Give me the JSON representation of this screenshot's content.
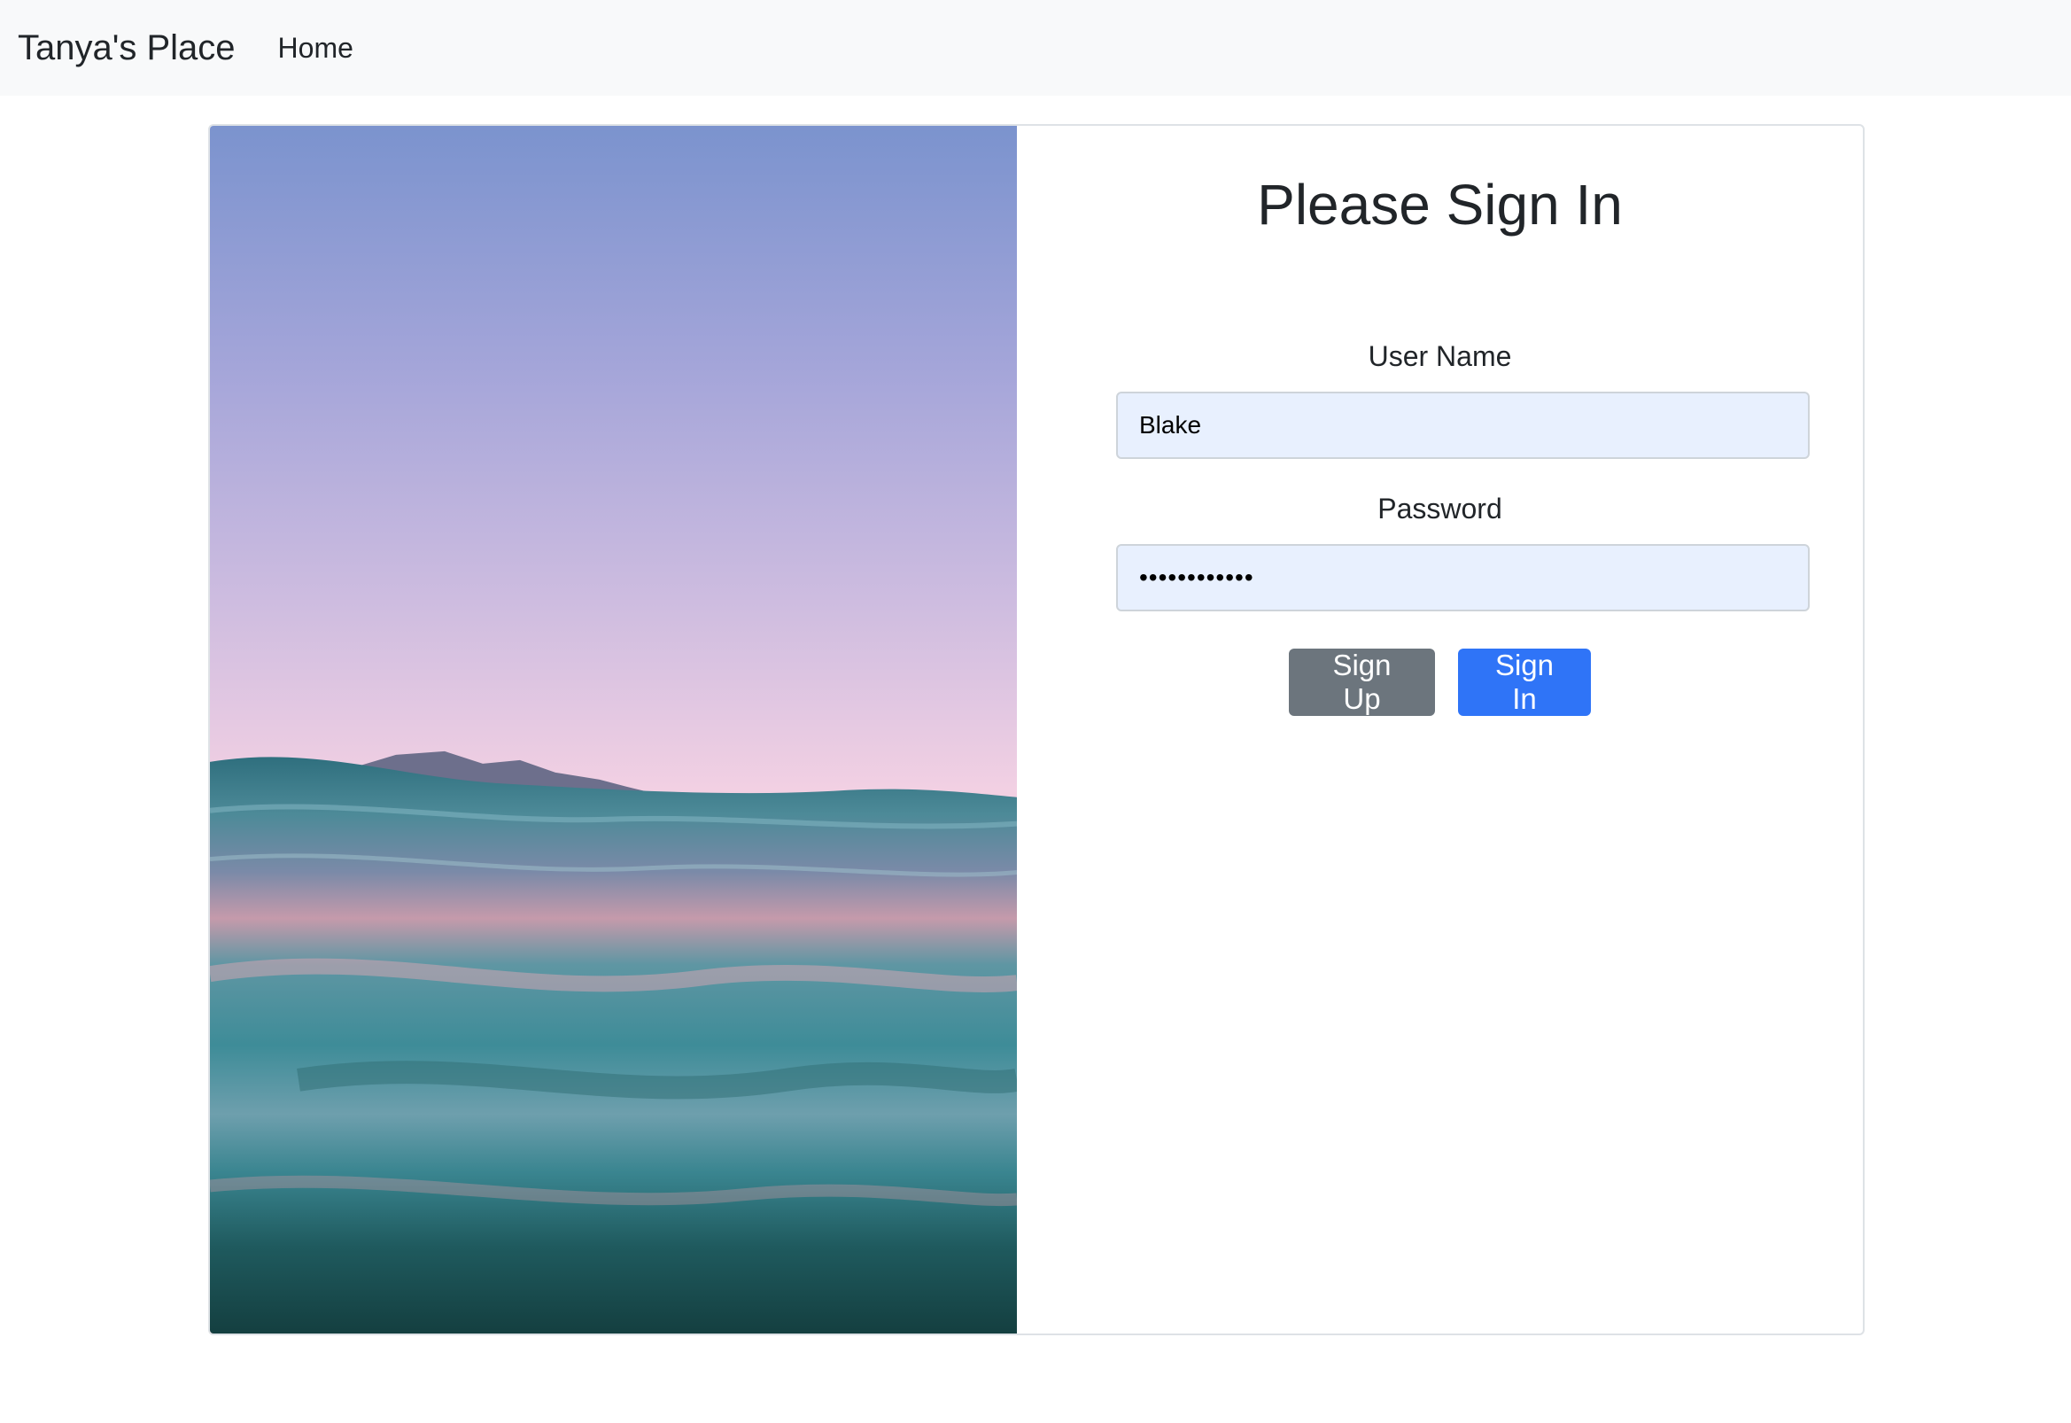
{
  "navbar": {
    "brand": "Tanya's Place",
    "links": [
      {
        "label": "Home"
      }
    ]
  },
  "hero_image": {
    "description_icon": "sunset-ocean-image"
  },
  "form": {
    "title": "Please Sign In",
    "username": {
      "label": "User Name",
      "value": "Blake"
    },
    "password": {
      "label": "Password",
      "value": "••••••••••••"
    },
    "buttons": {
      "sign_up": "Sign Up",
      "sign_in": "Sign In"
    }
  },
  "colors": {
    "navbar_bg": "#f8f9fa",
    "input_bg": "#e8f0fe",
    "secondary_button": "#6c757d",
    "primary_button": "#2f74f7"
  }
}
